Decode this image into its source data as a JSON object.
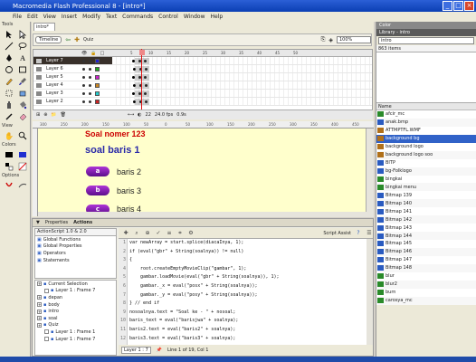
{
  "app": {
    "title": "Macromedia Flash Professional 8 - [intro*]"
  },
  "menu": [
    "File",
    "Edit",
    "View",
    "Insert",
    "Modify",
    "Text",
    "Commands",
    "Control",
    "Window",
    "Help"
  ],
  "tools_panel": {
    "title": "Tools",
    "view_label": "View",
    "colors_label": "Colors",
    "options_label": "Options"
  },
  "document": {
    "tab": "intro*",
    "edit_bar": {
      "scene": "Timeline",
      "path": "Quiz",
      "zoom": "100%"
    }
  },
  "timeline": {
    "layers": [
      {
        "name": "Layer 7",
        "selected": true
      },
      {
        "name": "Layer 6"
      },
      {
        "name": "Layer 5"
      },
      {
        "name": "Layer 4"
      },
      {
        "name": "Layer 3"
      },
      {
        "name": "Layer 2"
      }
    ],
    "footer": {
      "frame": "22",
      "fps": "24.0 fps",
      "time": "0.9s"
    },
    "ruler_ticks": [
      "5",
      "10",
      "15",
      "20",
      "25",
      "30",
      "35",
      "40",
      "45",
      "50"
    ]
  },
  "stage_ruler_ticks": [
    "300",
    "250",
    "200",
    "150",
    "100",
    "50",
    "0",
    "50",
    "100",
    "150",
    "200",
    "250",
    "300",
    "350",
    "400",
    "450"
  ],
  "stage": {
    "title": "Soal nomer 123",
    "subtitle": "soal baris 1",
    "options": [
      {
        "key": "a",
        "text": "baris 2"
      },
      {
        "key": "b",
        "text": "baris 3"
      },
      {
        "key": "c",
        "text": "baris 4"
      }
    ]
  },
  "actions": {
    "tabs": [
      "Properties",
      "Actions"
    ],
    "version_select": "ActionScript 1.0 & 2.0",
    "categories": [
      "Global Functions",
      "Global Properties",
      "Operators",
      "Statements"
    ],
    "tree": [
      {
        "label": "Current Selection",
        "indent": 0
      },
      {
        "label": "Layer 1 : Frame 7",
        "indent": 1
      },
      {
        "label": "depan",
        "indent": 0
      },
      {
        "label": "body",
        "indent": 0
      },
      {
        "label": "intro",
        "indent": 0
      },
      {
        "label": "soal",
        "indent": 0
      },
      {
        "label": "Quiz",
        "indent": 0
      },
      {
        "label": "Layer 1 : Frame 1",
        "indent": 1
      },
      {
        "label": "Layer 1 : Frame 7",
        "indent": 1
      }
    ],
    "script_assist": "Script Assist",
    "code": [
      "var newArray = start.splice(diacaInya, 1);",
      "if (eval(\"gbr\" + String(soalnya)) != null)",
      "{",
      "    root.createEmptyMovieClip(\"gambar\", 1);",
      "    gambar.loadMovie(eval(\"gbr\" + String(soalnya)), 1);",
      "    gambar._x = eval(\"posx\" + String(soalnya));",
      "    gambar._y = eval(\"posy\" + String(soalnya));",
      "} // end if",
      "nosoalnya.text = \"Soal ke - \" + nosoal;",
      "baris_text = eval(\"barisjwa\" + soalnya);",
      "baris2.text = eval(\"baris2\" + soalnya);",
      "baris3.text = eval(\"baris3\" + soalnya);"
    ],
    "footer_tab": "Layer 1 : 7",
    "status": "Line 1 of 19, Col 1"
  },
  "library": {
    "panels": [
      "Color",
      "Library - intro"
    ],
    "select": "intro",
    "count": "863 items",
    "name_header": "Name",
    "items": [
      {
        "name": "afcir_mc",
        "kind": "movie"
      },
      {
        "name": "anak.bmp",
        "kind": "bitmap"
      },
      {
        "name": "ATTMPTFL.WMF",
        "kind": "graphic"
      },
      {
        "name": "background bg",
        "kind": "graphic",
        "selected": true
      },
      {
        "name": "background logo",
        "kind": "graphic"
      },
      {
        "name": "background logo soo",
        "kind": "graphic"
      },
      {
        "name": "BITP",
        "kind": "bitmap"
      },
      {
        "name": "bg-Folklogo",
        "kind": "bitmap"
      },
      {
        "name": "bingkai",
        "kind": "movie"
      },
      {
        "name": "bingkai menu",
        "kind": "movie"
      },
      {
        "name": "Bitmap 139",
        "kind": "bitmap"
      },
      {
        "name": "Bitmap 140",
        "kind": "bitmap"
      },
      {
        "name": "Bitmap 141",
        "kind": "bitmap"
      },
      {
        "name": "Bitmap 142",
        "kind": "bitmap"
      },
      {
        "name": "Bitmap 143",
        "kind": "bitmap"
      },
      {
        "name": "Bitmap 144",
        "kind": "bitmap"
      },
      {
        "name": "Bitmap 145",
        "kind": "bitmap"
      },
      {
        "name": "Bitmap 146",
        "kind": "bitmap"
      },
      {
        "name": "Bitmap 147",
        "kind": "bitmap"
      },
      {
        "name": "Bitmap 148",
        "kind": "bitmap"
      },
      {
        "name": "blur",
        "kind": "movie"
      },
      {
        "name": "blur2",
        "kind": "movie"
      },
      {
        "name": "burn",
        "kind": "movie"
      },
      {
        "name": "carosya_mc",
        "kind": "movie"
      }
    ]
  },
  "colors": {
    "accent": "#0b3fb4",
    "stage": "#ffffcc",
    "title_red": "#cc0000",
    "subtitle_blue": "#2a2aa8",
    "option_purple": "#8a1fb8"
  }
}
